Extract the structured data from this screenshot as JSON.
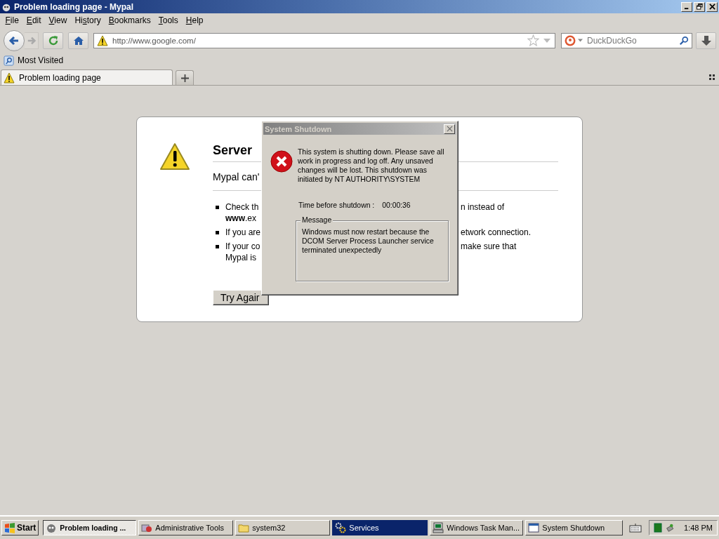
{
  "window": {
    "title": "Problem loading page - Mypal"
  },
  "menu": [
    {
      "key": "F",
      "rest": "ile"
    },
    {
      "key": "E",
      "rest": "dit"
    },
    {
      "key": "V",
      "rest": "iew"
    },
    {
      "lead": "Hi",
      "key": "s",
      "rest": "tory"
    },
    {
      "key": "B",
      "rest": "ookmarks"
    },
    {
      "key": "T",
      "rest": "ools"
    },
    {
      "key": "H",
      "rest": "elp"
    }
  ],
  "navigation": {
    "url": "http://www.google.com/",
    "search_placeholder": "DuckDuckGo"
  },
  "bookmarks": [
    {
      "label": "Most Visited"
    }
  ],
  "tabs": [
    {
      "label": "Problem loading page",
      "selected": true
    }
  ],
  "error_page": {
    "title": "Server",
    "subtitle": "Mypal can'",
    "items": [
      {
        "lines": [
          {
            "left": "Check th",
            "right": "n instead of"
          },
          {
            "left": "**www**.ex"
          }
        ]
      },
      {
        "lines": [
          {
            "left": "If you are",
            "right": "etwork connection."
          }
        ]
      },
      {
        "lines": [
          {
            "left": "If your co",
            "right": "make sure that"
          },
          {
            "left": "Mypal is"
          }
        ]
      }
    ],
    "button": "Try Agair"
  },
  "dialog": {
    "title": "System Shutdown",
    "message": "This system is shutting down. Please save all work in progress and log off. Any unsaved changes will be lost. This shutdown was initiated by NT AUTHORITY\\SYSTEM",
    "time_label": "Time before shutdown :",
    "time": "00:00:36",
    "group_label": "Message",
    "group_text": "Windows must now restart because the DCOM Server Process Launcher service terminated unexpectedly"
  },
  "taskbar": {
    "start": "Start",
    "buttons": [
      {
        "label": "Problem loading ...",
        "kind": "browser",
        "selected": true,
        "flashing": false
      },
      {
        "label": "Administrative Tools",
        "kind": "tools",
        "selected": false,
        "flashing": false
      },
      {
        "label": "system32",
        "kind": "folder",
        "selected": false,
        "flashing": false
      },
      {
        "label": "Services",
        "kind": "services",
        "selected": false,
        "flashing": true
      },
      {
        "label": "Windows Task Man...",
        "kind": "computer",
        "selected": false,
        "flashing": false
      },
      {
        "label": "System Shutdown",
        "kind": "window",
        "selected": false,
        "flashing": false
      }
    ],
    "clock": "1:48 PM"
  }
}
